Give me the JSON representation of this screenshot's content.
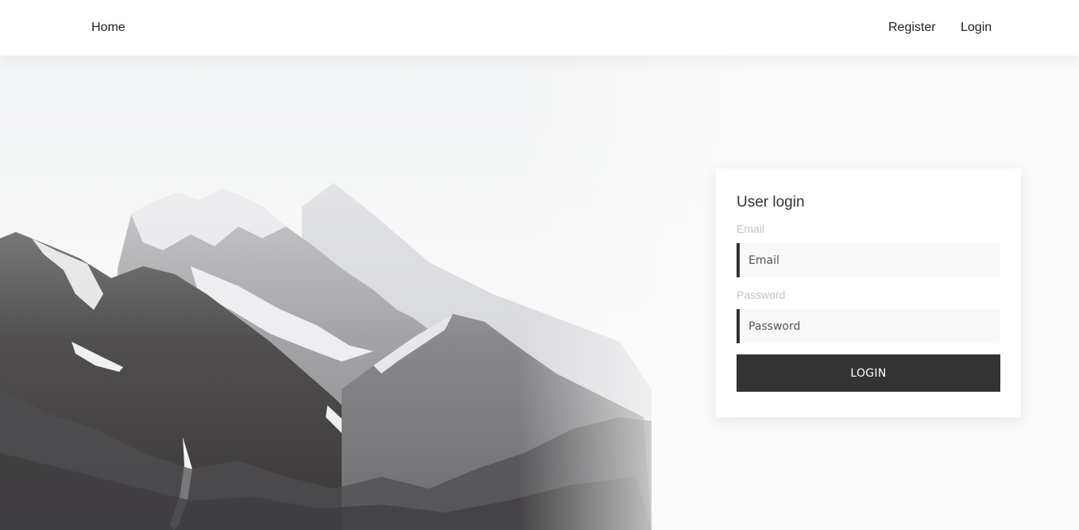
{
  "nav": {
    "home_label": "Home",
    "register_label": "Register",
    "login_label": "Login"
  },
  "login_form": {
    "title": "User login",
    "email_label": "Email",
    "email_placeholder": "Email",
    "email_value": "",
    "password_label": "Password",
    "password_placeholder": "Password",
    "password_value": "",
    "submit_label": "LOGIN"
  },
  "colors": {
    "accent": "#333333",
    "page_background": "#fafafa",
    "navbar_background": "#ffffff",
    "input_background": "#f8f8f8",
    "label_text": "#c4c4c4"
  },
  "hero": {
    "image_subject": "snow-capped-mountain-fading-to-white"
  }
}
